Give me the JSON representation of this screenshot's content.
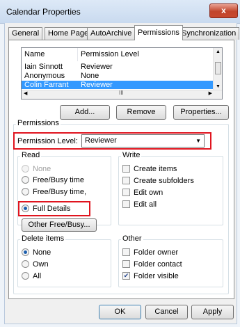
{
  "window": {
    "title": "Calendar Properties",
    "close_glyph": "x"
  },
  "tabs": [
    "General",
    "Home Page",
    "AutoArchive",
    "Permissions",
    "Synchronization"
  ],
  "list": {
    "headers": [
      "Name",
      "Permission Level"
    ],
    "rows": [
      {
        "name": "Iain Sinnott",
        "level": "Reviewer"
      },
      {
        "name": "Anonymous",
        "level": "None"
      },
      {
        "name": "Colin Farrant",
        "level": "Reviewer"
      }
    ],
    "hscroll_grip": "III"
  },
  "buttons": {
    "add": "Add...",
    "remove": "Remove",
    "properties": "Properties...",
    "other_freebusy": "Other Free/Busy...",
    "ok": "OK",
    "cancel": "Cancel",
    "apply": "Apply"
  },
  "permissions": {
    "group_label": "Permissions",
    "level_label": "Permission Level:",
    "level_value": "Reviewer",
    "read": {
      "label": "Read",
      "options": [
        "None",
        "Free/Busy time",
        "Free/Busy time, subject, location",
        "Full Details"
      ],
      "selected": "Full Details"
    },
    "write": {
      "label": "Write",
      "options": [
        "Create items",
        "Create subfolders",
        "Edit own",
        "Edit all"
      ]
    },
    "delete": {
      "label": "Delete items",
      "options": [
        "None",
        "Own",
        "All"
      ],
      "selected": "None"
    },
    "other": {
      "label": "Other",
      "options": [
        "Folder owner",
        "Folder contact",
        "Folder visible"
      ],
      "checked": [
        "Folder visible"
      ]
    }
  },
  "colors": {
    "highlight": "#e0141e",
    "selection": "#3399ff"
  }
}
